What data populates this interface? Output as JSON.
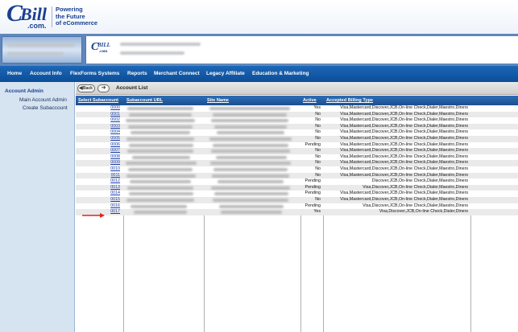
{
  "brand": {
    "logo_mark_c1": "C",
    "logo_mark_c2": "Bill",
    "logo_dotcom": ".com.",
    "tagline_lines": [
      "Powering",
      "the Future",
      "of eCommerce"
    ],
    "color_primary": "#1a3f8f"
  },
  "mini_logo": {
    "a": "C",
    "b": "BILL",
    "c": ".com"
  },
  "nav": {
    "items": [
      {
        "label": "Home"
      },
      {
        "label": "Account Info"
      },
      {
        "label": "FlexForms Systems"
      },
      {
        "label": "Reports"
      },
      {
        "label": "Merchant Connect"
      },
      {
        "label": "Legacy Affiliate"
      },
      {
        "label": "Education & Marketing"
      }
    ]
  },
  "sidebar": {
    "heading": "Account Admin",
    "items": [
      {
        "label": "Main Account Admin"
      },
      {
        "label": "Create Subaccount"
      }
    ]
  },
  "toolbar": {
    "back_label": "Back",
    "forward_icon": "forward-arrow-icon",
    "title": "Account List"
  },
  "table": {
    "columns": [
      "Select Subaccount",
      "Subaccount URL",
      "Site Name",
      "Active",
      "Accepted Billing Type"
    ],
    "rows": [
      {
        "id": "0000",
        "active": "Yes",
        "billing": "Visa,Mastercard,Discover,JCB,On-line Check,Dialer,Maestro,Diners"
      },
      {
        "id": "0001",
        "active": "No",
        "billing": "Visa,Mastercard,Discover,JCB,On-line Check,Dialer,Maestro,Diners"
      },
      {
        "id": "0002",
        "active": "No",
        "billing": "Visa,Mastercard,Discover,JCB,On-line Check,Dialer,Maestro,Diners"
      },
      {
        "id": "0003",
        "active": "No",
        "billing": "Visa,Mastercard,Discover,JCB,On-line Check,Dialer,Maestro,Diners"
      },
      {
        "id": "0004",
        "active": "No",
        "billing": "Visa,Mastercard,Discover,JCB,On-line Check,Dialer,Maestro,Diners"
      },
      {
        "id": "0005",
        "active": "No",
        "billing": "Visa,Mastercard,Discover,JCB,On-line Check,Dialer,Maestro,Diners"
      },
      {
        "id": "0006",
        "active": "Pending",
        "billing": "Visa,Mastercard,Discover,JCB,On-line Check,Dialer,Maestro,Diners"
      },
      {
        "id": "0007",
        "active": "No",
        "billing": "Visa,Mastercard,Discover,JCB,On-line Check,Dialer,Maestro,Diners"
      },
      {
        "id": "0008",
        "active": "No",
        "billing": "Visa,Mastercard,Discover,JCB,On-line Check,Dialer,Maestro,Diners"
      },
      {
        "id": "0009",
        "active": "No",
        "billing": "Visa,Mastercard,Discover,JCB,On-line Check,Dialer,Maestro,Diners"
      },
      {
        "id": "0010",
        "active": "No",
        "billing": "Visa,Mastercard,Discover,JCB,On-line Check,Dialer,Maestro,Diners"
      },
      {
        "id": "0011",
        "active": "No",
        "billing": "Visa,Mastercard,Discover,JCB,On-line Check,Dialer,Maestro,Diners"
      },
      {
        "id": "0012",
        "active": "Pending",
        "billing": "Discover,JCB,On-line Check,Dialer,Maestro,Diners"
      },
      {
        "id": "0013",
        "active": "Pending",
        "billing": "Visa,Discover,JCB,On-line Check,Dialer,Maestro,Diners"
      },
      {
        "id": "0014",
        "active": "Pending",
        "billing": "Visa,Mastercard,Discover,JCB,On-line Check,Dialer,Maestro,Diners"
      },
      {
        "id": "0015",
        "active": "No",
        "billing": "Visa,Mastercard,Discover,JCB,On-line Check,Dialer,Maestro,Diners"
      },
      {
        "id": "0016",
        "active": "Pending",
        "billing": "Visa,Discover,JCB,On-line Check,Dialer,Maestro,Diners"
      },
      {
        "id": "0017",
        "active": "Yes",
        "billing": "Visa,Discover,JCB,On-line Check,Dialer,Diners"
      }
    ]
  },
  "annotation_color": "#e0231f"
}
